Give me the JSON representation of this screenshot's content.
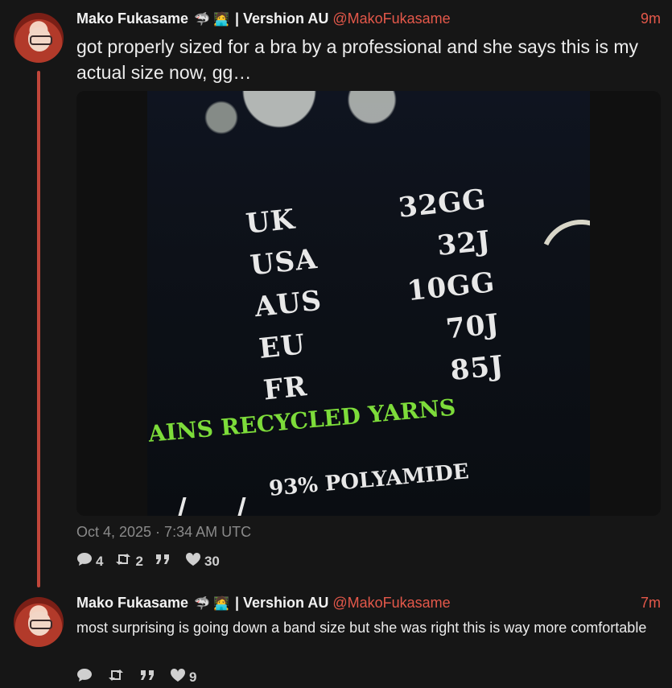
{
  "posts": [
    {
      "author": "Mako Fukasame",
      "emojis": [
        "🦈",
        "🧑‍💻"
      ],
      "display_suffix": "| Vershion AU",
      "handle": "@MakoFukasame",
      "time": "9m",
      "text": "got properly sized for a bra by a professional and she says this is my actual size now, gg…",
      "image": {
        "sizes": [
          {
            "region": "UK",
            "size": "32GG"
          },
          {
            "region": "USA",
            "size": "32J"
          },
          {
            "region": "AUS",
            "size": "10GG"
          },
          {
            "region": "EU",
            "size": "70J"
          },
          {
            "region": "FR",
            "size": "85J"
          }
        ],
        "recycled_text": "AINS RECYCLED YARNS",
        "material_text": "93% POLYAMIDE"
      },
      "timestamp": "Oct 4, 2025 · 7:34 AM UTC",
      "stats": {
        "replies": "4",
        "reposts": "2",
        "quotes": "",
        "likes": "30"
      }
    },
    {
      "author": "Mako Fukasame",
      "emojis": [
        "🦈",
        "🧑‍💻"
      ],
      "display_suffix": "| Vershion AU",
      "handle": "@MakoFukasame",
      "time": "7m",
      "text": "most surprising is going down a band size but she was right this is way more comfortable",
      "stats": {
        "replies": "",
        "reposts": "",
        "quotes": "",
        "likes": "9"
      }
    }
  ],
  "icons": {
    "reply": "speech-bubble-icon",
    "repost": "repost-icon",
    "quote": "quote-icon",
    "like": "heart-icon"
  },
  "colors": {
    "accent": "#e4584a",
    "background": "#161616",
    "thread_line": "#c0463a",
    "recycled_green": "#7ddc3a"
  }
}
